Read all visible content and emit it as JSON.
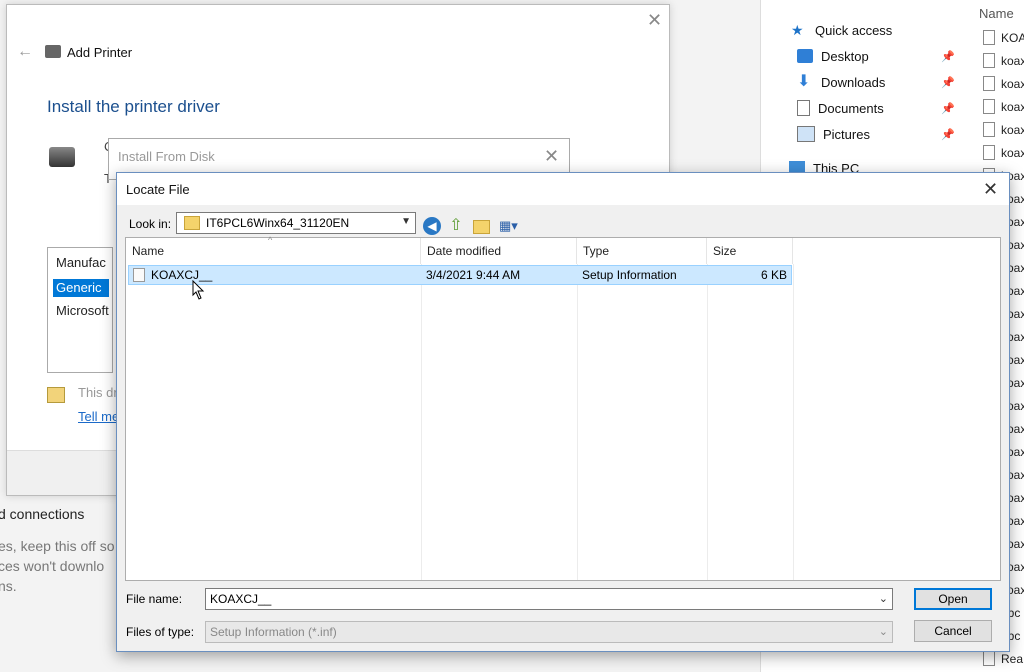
{
  "background": {
    "settings_lines": [
      "d connections",
      "es, keep this off so",
      "ces won't downlo",
      "ns."
    ]
  },
  "explorer": {
    "column_name": "Name",
    "quick_access": "Quick access",
    "nav_items": [
      {
        "label": "Desktop"
      },
      {
        "label": "Downloads"
      },
      {
        "label": "Documents"
      },
      {
        "label": "Pictures"
      },
      {
        "label": "This PC"
      }
    ],
    "files": [
      "KOA",
      "koax",
      "koax",
      "koax",
      "koax",
      "koax",
      "koax",
      "koax",
      "koax",
      "koax",
      "koax",
      "koax",
      "koax",
      "koax",
      "koax",
      "koax",
      "koax",
      "koax",
      "koax",
      "koax",
      "koax",
      "koax",
      "koax",
      "koax",
      "koax",
      "obc",
      "obc",
      "Rea"
    ]
  },
  "wizard": {
    "title": "Add Printer",
    "heading": "Install the printer driver",
    "frag_c": "C",
    "frag_t": "T",
    "manufacturer_header": "Manufac",
    "manufacturers": [
      "Generic",
      "Microsoft"
    ],
    "signed_text": "This dri",
    "tell_me_link": "Tell me"
  },
  "disk_dialog": {
    "title": "Install From Disk"
  },
  "locate": {
    "title": "Locate File",
    "look_in_label": "Look in:",
    "look_in_value": "IT6PCL6Winx64_31120EN",
    "columns": [
      "Name",
      "Date modified",
      "Type",
      "Size"
    ],
    "files": [
      {
        "name": "KOAXCJ__",
        "date": "3/4/2021 9:44 AM",
        "type": "Setup Information",
        "size": "6 KB"
      }
    ],
    "file_name_label": "File name:",
    "file_name_value": "KOAXCJ__",
    "files_of_type_label": "Files of type:",
    "files_of_type_value": "Setup Information (*.inf)",
    "open_label": "Open",
    "cancel_label": "Cancel"
  }
}
